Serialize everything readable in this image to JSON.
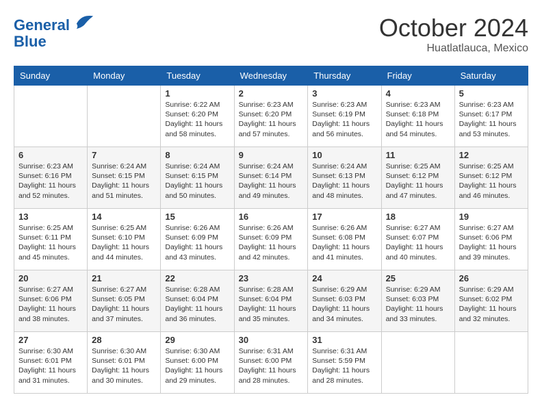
{
  "header": {
    "logo_line1": "General",
    "logo_line2": "Blue",
    "month": "October 2024",
    "location": "Huatlatlauca, Mexico"
  },
  "days_of_week": [
    "Sunday",
    "Monday",
    "Tuesday",
    "Wednesday",
    "Thursday",
    "Friday",
    "Saturday"
  ],
  "weeks": [
    [
      {
        "day": "",
        "info": ""
      },
      {
        "day": "",
        "info": ""
      },
      {
        "day": "1",
        "info": "Sunrise: 6:22 AM\nSunset: 6:20 PM\nDaylight: 11 hours and 58 minutes."
      },
      {
        "day": "2",
        "info": "Sunrise: 6:23 AM\nSunset: 6:20 PM\nDaylight: 11 hours and 57 minutes."
      },
      {
        "day": "3",
        "info": "Sunrise: 6:23 AM\nSunset: 6:19 PM\nDaylight: 11 hours and 56 minutes."
      },
      {
        "day": "4",
        "info": "Sunrise: 6:23 AM\nSunset: 6:18 PM\nDaylight: 11 hours and 54 minutes."
      },
      {
        "day": "5",
        "info": "Sunrise: 6:23 AM\nSunset: 6:17 PM\nDaylight: 11 hours and 53 minutes."
      }
    ],
    [
      {
        "day": "6",
        "info": "Sunrise: 6:23 AM\nSunset: 6:16 PM\nDaylight: 11 hours and 52 minutes."
      },
      {
        "day": "7",
        "info": "Sunrise: 6:24 AM\nSunset: 6:15 PM\nDaylight: 11 hours and 51 minutes."
      },
      {
        "day": "8",
        "info": "Sunrise: 6:24 AM\nSunset: 6:15 PM\nDaylight: 11 hours and 50 minutes."
      },
      {
        "day": "9",
        "info": "Sunrise: 6:24 AM\nSunset: 6:14 PM\nDaylight: 11 hours and 49 minutes."
      },
      {
        "day": "10",
        "info": "Sunrise: 6:24 AM\nSunset: 6:13 PM\nDaylight: 11 hours and 48 minutes."
      },
      {
        "day": "11",
        "info": "Sunrise: 6:25 AM\nSunset: 6:12 PM\nDaylight: 11 hours and 47 minutes."
      },
      {
        "day": "12",
        "info": "Sunrise: 6:25 AM\nSunset: 6:12 PM\nDaylight: 11 hours and 46 minutes."
      }
    ],
    [
      {
        "day": "13",
        "info": "Sunrise: 6:25 AM\nSunset: 6:11 PM\nDaylight: 11 hours and 45 minutes."
      },
      {
        "day": "14",
        "info": "Sunrise: 6:25 AM\nSunset: 6:10 PM\nDaylight: 11 hours and 44 minutes."
      },
      {
        "day": "15",
        "info": "Sunrise: 6:26 AM\nSunset: 6:09 PM\nDaylight: 11 hours and 43 minutes."
      },
      {
        "day": "16",
        "info": "Sunrise: 6:26 AM\nSunset: 6:09 PM\nDaylight: 11 hours and 42 minutes."
      },
      {
        "day": "17",
        "info": "Sunrise: 6:26 AM\nSunset: 6:08 PM\nDaylight: 11 hours and 41 minutes."
      },
      {
        "day": "18",
        "info": "Sunrise: 6:27 AM\nSunset: 6:07 PM\nDaylight: 11 hours and 40 minutes."
      },
      {
        "day": "19",
        "info": "Sunrise: 6:27 AM\nSunset: 6:06 PM\nDaylight: 11 hours and 39 minutes."
      }
    ],
    [
      {
        "day": "20",
        "info": "Sunrise: 6:27 AM\nSunset: 6:06 PM\nDaylight: 11 hours and 38 minutes."
      },
      {
        "day": "21",
        "info": "Sunrise: 6:27 AM\nSunset: 6:05 PM\nDaylight: 11 hours and 37 minutes."
      },
      {
        "day": "22",
        "info": "Sunrise: 6:28 AM\nSunset: 6:04 PM\nDaylight: 11 hours and 36 minutes."
      },
      {
        "day": "23",
        "info": "Sunrise: 6:28 AM\nSunset: 6:04 PM\nDaylight: 11 hours and 35 minutes."
      },
      {
        "day": "24",
        "info": "Sunrise: 6:29 AM\nSunset: 6:03 PM\nDaylight: 11 hours and 34 minutes."
      },
      {
        "day": "25",
        "info": "Sunrise: 6:29 AM\nSunset: 6:03 PM\nDaylight: 11 hours and 33 minutes."
      },
      {
        "day": "26",
        "info": "Sunrise: 6:29 AM\nSunset: 6:02 PM\nDaylight: 11 hours and 32 minutes."
      }
    ],
    [
      {
        "day": "27",
        "info": "Sunrise: 6:30 AM\nSunset: 6:01 PM\nDaylight: 11 hours and 31 minutes."
      },
      {
        "day": "28",
        "info": "Sunrise: 6:30 AM\nSunset: 6:01 PM\nDaylight: 11 hours and 30 minutes."
      },
      {
        "day": "29",
        "info": "Sunrise: 6:30 AM\nSunset: 6:00 PM\nDaylight: 11 hours and 29 minutes."
      },
      {
        "day": "30",
        "info": "Sunrise: 6:31 AM\nSunset: 6:00 PM\nDaylight: 11 hours and 28 minutes."
      },
      {
        "day": "31",
        "info": "Sunrise: 6:31 AM\nSunset: 5:59 PM\nDaylight: 11 hours and 28 minutes."
      },
      {
        "day": "",
        "info": ""
      },
      {
        "day": "",
        "info": ""
      }
    ]
  ]
}
